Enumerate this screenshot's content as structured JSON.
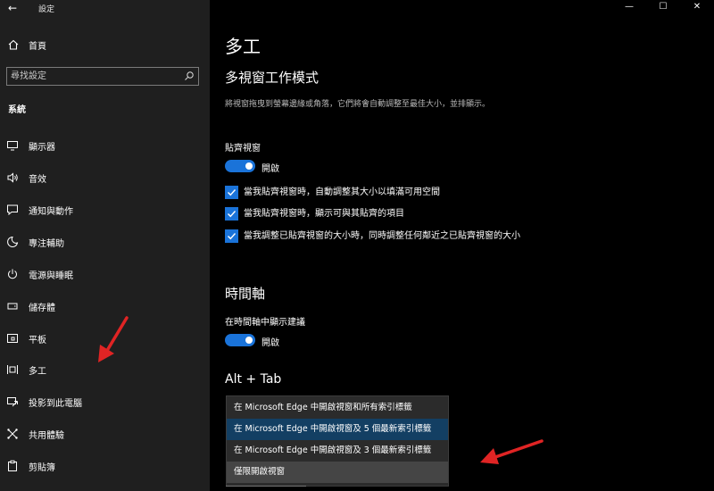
{
  "window": {
    "title": "設定",
    "controls": {
      "minimize": "—",
      "maximize": "☐",
      "close": "✕"
    }
  },
  "sidebar": {
    "home_label": "首頁",
    "search_placeholder": "尋找設定",
    "section_title": "系統",
    "items": [
      {
        "label": "顯示器",
        "icon": "monitor-icon"
      },
      {
        "label": "音效",
        "icon": "speaker-icon"
      },
      {
        "label": "通知與動作",
        "icon": "notification-icon"
      },
      {
        "label": "專注輔助",
        "icon": "moon-icon"
      },
      {
        "label": "電源與睡眠",
        "icon": "power-icon"
      },
      {
        "label": "儲存體",
        "icon": "storage-icon"
      },
      {
        "label": "平板",
        "icon": "tablet-icon"
      },
      {
        "label": "多工",
        "icon": "multitasking-icon"
      },
      {
        "label": "投影到此電腦",
        "icon": "project-icon"
      },
      {
        "label": "共用體驗",
        "icon": "shared-experiences-icon"
      },
      {
        "label": "剪貼簿",
        "icon": "clipboard-icon"
      }
    ]
  },
  "main": {
    "page_title": "多工",
    "snap": {
      "heading": "多視窗工作模式",
      "description": "將視窗拖曳到螢幕邊緣或角落，它們將會自動調整至最佳大小，並排顯示。",
      "toggle_label_caption": "貼齊視窗",
      "toggle_state": "開啟",
      "checkboxes": [
        {
          "label": "當我貼齊視窗時，自動調整其大小以填滿可用空間",
          "checked": true
        },
        {
          "label": "當我貼齊視窗時，顯示可與其貼齊的項目",
          "checked": true
        },
        {
          "label": "當我調整已貼齊視窗的大小時，同時調整任何鄰近之已貼齊視窗的大小",
          "checked": true
        }
      ]
    },
    "timeline": {
      "heading": "時間軸",
      "toggle_caption": "在時間軸中顯示建議",
      "toggle_state": "開啟"
    },
    "alt_tab": {
      "heading": "Alt + Tab",
      "options": [
        "在 Microsoft Edge 中開啟視窗和所有索引標籤",
        "在 Microsoft Edge 中開啟視窗及 5 個最新索引標籤",
        "在 Microsoft Edge 中開啟視窗及 3 個最新索引標籤",
        "僅限開啟視窗"
      ],
      "selected_index": 1
    }
  },
  "colors": {
    "accent": "#1a73d9",
    "annotation_arrow": "#e02424",
    "sidebar_bg": "#1f1f1f",
    "content_bg": "#000000"
  }
}
